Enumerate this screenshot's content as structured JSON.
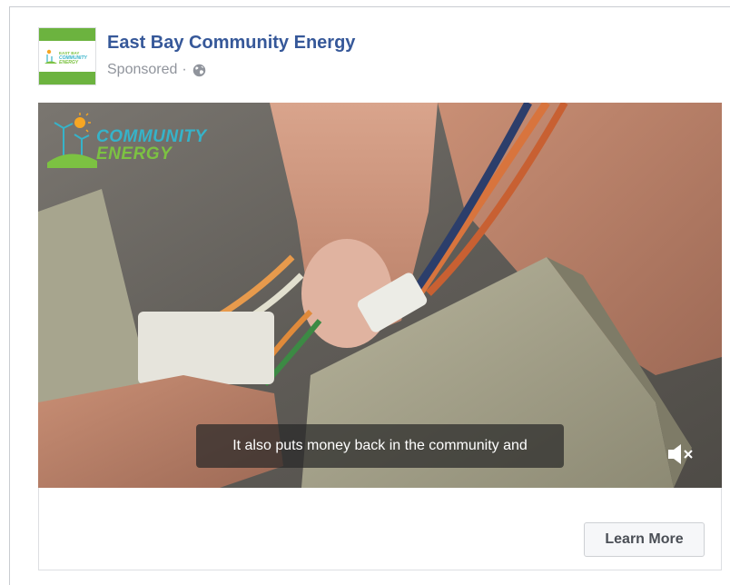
{
  "post": {
    "page_name": "East Bay Community Energy",
    "sponsored_label": "Sponsored",
    "separator": "·",
    "audience_icon": "globe-icon"
  },
  "avatar": {
    "logo_small_text_line1": "EAST BAY",
    "logo_small_text_line2": "COMMUNITY",
    "logo_small_text_line3": "ENERGY"
  },
  "video": {
    "overlay_brand_line1": "COMMUNITY",
    "overlay_brand_line2": "ENERGY",
    "caption": "It also puts money back in the community and",
    "mute_icon": "speaker-muted-icon"
  },
  "footer": {
    "cta_label": "Learn More"
  },
  "colors": {
    "page_name": "#365899",
    "meta_text": "#90949c",
    "brand_teal": "#36b3c9",
    "brand_green": "#7cc242",
    "button_bg": "#f6f7f9",
    "button_text": "#4b4f56"
  }
}
